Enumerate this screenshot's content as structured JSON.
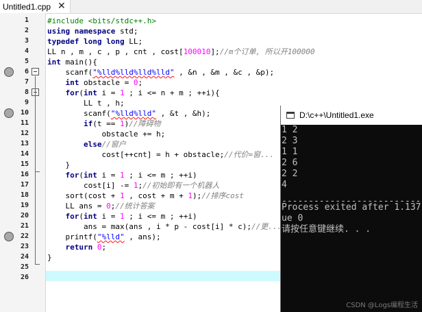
{
  "tab": {
    "label": "Untitled1.cpp",
    "close": "✕"
  },
  "gutter": {
    "line_numbers": [
      "1",
      "2",
      "3",
      "4",
      "5",
      "6",
      "7",
      "8",
      "9",
      "10",
      "11",
      "12",
      "13",
      "14",
      "15",
      "16",
      "17",
      "18",
      "19",
      "20",
      "21",
      "22",
      "23",
      "24",
      "25",
      "26"
    ],
    "breakpoint_lines": [
      6,
      10,
      22
    ],
    "fold_markers": [
      6,
      8
    ]
  },
  "code": {
    "l1_a": "#include <bits/stdc++.h>",
    "l2_kw": "using namespace",
    "l2_b": " std;",
    "l3_kw": "typedef long long",
    "l3_b": " LL;",
    "l4_a": "LL n , m , c , p , cnt , cost[",
    "l4_num": "100010",
    "l4_b": "];",
    "l4_cm": "//m个订单, 所以开100000",
    "l5_kw": "int",
    "l5_b": " main(){",
    "l6_a": "    scanf(",
    "l6_str": "\"%lld%lld%lld%lld\"",
    "l6_b": " , &n , &m , &c , &p);",
    "l7_kw": "    int",
    "l7_b": " obstacle = ",
    "l7_num": "0",
    "l7_c": ";",
    "l8_kw": "    for",
    "l8_b": "(",
    "l8_kw2": "int",
    "l8_c": " i = ",
    "l8_num": "1",
    "l8_d": " ; i <= n + m ; ++i){",
    "l9_a": "        LL t , h;",
    "l10_a": "        scanf(",
    "l10_str": "\"%lld%lld\"",
    "l10_b": " , &t , &h);",
    "l11_kw": "        if",
    "l11_b": "(t == ",
    "l11_num": "1",
    "l11_c": ")",
    "l11_cm": "//障碍物",
    "l12_a": "            obstacle += h;",
    "l13_kw": "        else",
    "l13_cm": "//窗户",
    "l14_a": "            cost[++cnt] = h + obstacle;",
    "l14_cm": "//代价=窗...",
    "l15_a": "    }",
    "l16_kw": "    for",
    "l16_b": "(",
    "l16_kw2": "int",
    "l16_c": " i = ",
    "l16_num": "1",
    "l16_d": " ; i <= m ; ++i)",
    "l17_a": "        cost[i] -= ",
    "l17_num": "1",
    "l17_b": ";",
    "l17_cm": "//初始即有一个机器人",
    "l18_a": "    sort(cost + ",
    "l18_num": "1",
    "l18_b": " , cost + m + ",
    "l18_num2": "1",
    "l18_c": ");",
    "l18_cm": "//排序cost",
    "l19_a": "    LL ans = ",
    "l19_num": "0",
    "l19_b": ";",
    "l19_cm": "//统计答案",
    "l20_kw": "    for",
    "l20_b": "(",
    "l20_kw2": "int",
    "l20_c": " i = ",
    "l20_num": "1",
    "l20_d": " ; i <= m ; ++i)",
    "l21_a": "        ans = max(ans , i * p - cost[i] * c);",
    "l21_cm": "//更...",
    "l22_a": "    printf(",
    "l22_str": "\"%lld\"",
    "l22_b": " , ans);",
    "l23_kw": "    return",
    "l23_b": " ",
    "l23_num": "0",
    "l23_c": ";",
    "l24_a": "}"
  },
  "console": {
    "title": "D:\\c++\\Untitled1.exe",
    "lines": [
      "1 2",
      "2 3",
      "1 1",
      "2 6",
      "2 2",
      "4",
      "",
      "--------------------------------",
      "Process exited after 1.137",
      "ue 0",
      "请按任意键继续. . ."
    ]
  },
  "watermark": "CSDN @Logs编程生活",
  "colors": {
    "active_line": "#cdfafd",
    "keyword": "#000080",
    "preprocessor": "#008000",
    "number": "#ff00ff",
    "string": "#0000ff",
    "comment": "#808080",
    "console_bg": "#0c0c0c",
    "console_fg": "#c0c0c0"
  }
}
